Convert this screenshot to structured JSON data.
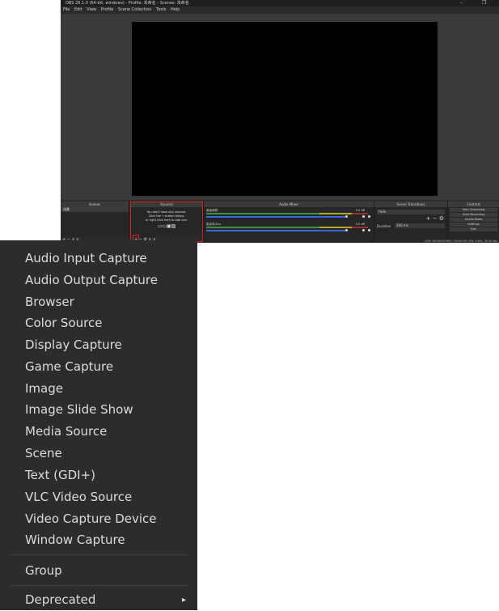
{
  "window": {
    "title": "OBS 26.1.0 (64-bit, windows) - Profile: 未命名 - Scenes: 未命名"
  },
  "menubar": {
    "items": [
      "File",
      "Edit",
      "View",
      "Profile",
      "Scene Collection",
      "Tools",
      "Help"
    ]
  },
  "docks": {
    "scenes": {
      "header": "Scenes",
      "items": [
        "场景"
      ]
    },
    "sources": {
      "header": "Sources",
      "empty_line1": "You don't have any sources.",
      "empty_line2": "Click the + button below,",
      "empty_line3": "or right click here to add one."
    },
    "mixer": {
      "header": "Audio Mixer",
      "channels": [
        {
          "name": "桌面音频",
          "db": "0.0 dB"
        },
        {
          "name": "麦克风/Aux",
          "db": "0.0 dB"
        }
      ]
    },
    "transitions": {
      "header": "Scene Transitions",
      "type": "Fade",
      "duration_label": "Duration",
      "duration": "300 ms"
    },
    "controls": {
      "header": "Controls",
      "buttons": [
        "Start Streaming",
        "Start Recording",
        "Studio Mode",
        "Settings",
        "Exit"
      ]
    },
    "status": "LIVE: 00:00:00   REC: 00:00:00   CPU: 0.8%, 30.00 fps"
  },
  "context_menu": {
    "items": [
      "Audio Input Capture",
      "Audio Output Capture",
      "Browser",
      "Color Source",
      "Display Capture",
      "Game Capture",
      "Image",
      "Image Slide Show",
      "Media Source",
      "Scene",
      "Text (GDI+)",
      "VLC Video Source",
      "Video Capture Device",
      "Window Capture"
    ],
    "group": "Group",
    "deprecated": "Deprecated"
  },
  "colors": {
    "highlight": "#d42020",
    "menu_bg": "#2c2c2c",
    "menu_text": "#dcdcdc",
    "preview_bg": "#000000"
  }
}
